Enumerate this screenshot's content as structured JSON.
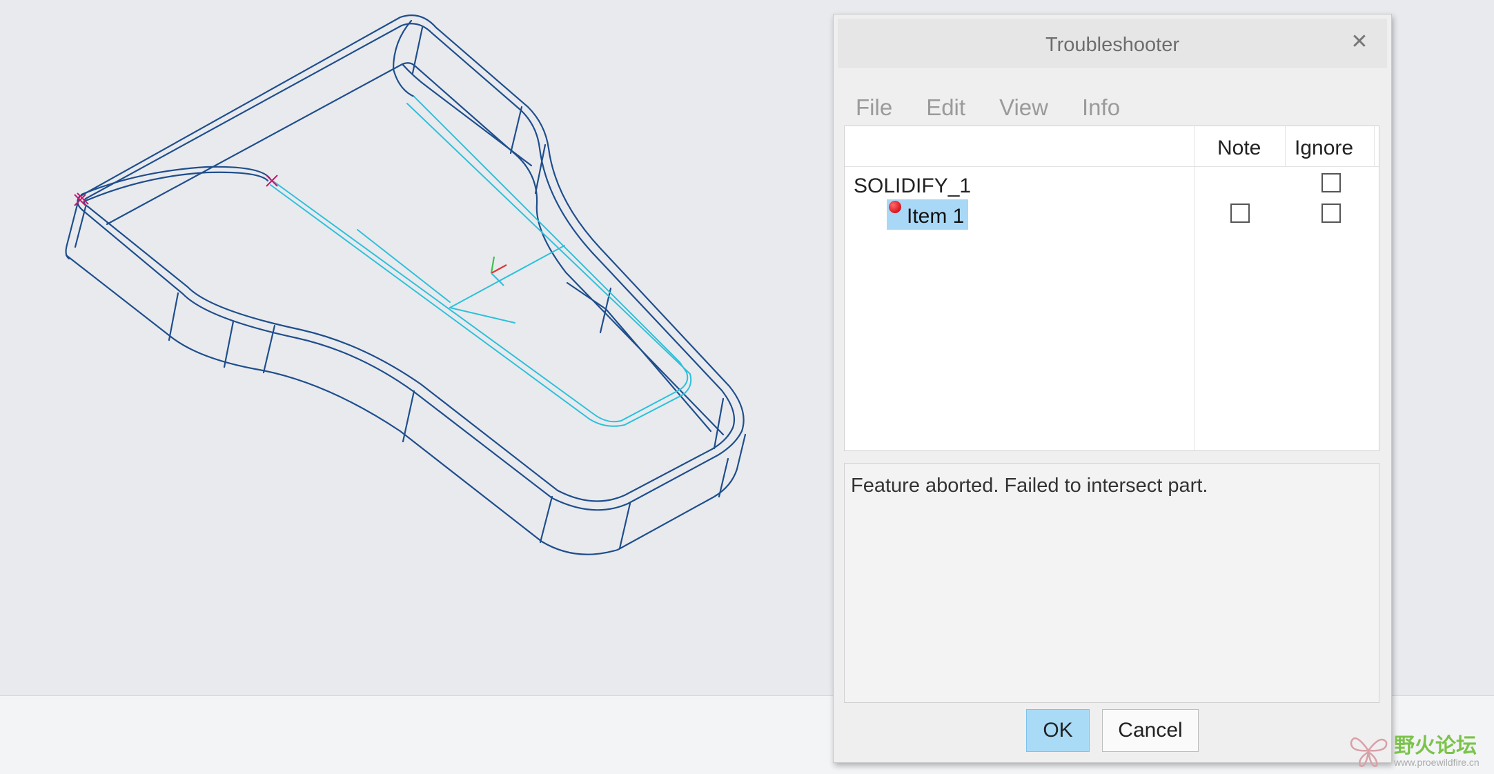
{
  "dialog": {
    "title": "Troubleshooter",
    "close_icon": "close-icon"
  },
  "menu": {
    "items": [
      {
        "label": "File"
      },
      {
        "label": "Edit"
      },
      {
        "label": "View"
      },
      {
        "label": "Info"
      }
    ]
  },
  "tree": {
    "columns": {
      "note": "Note",
      "ignore": "Ignore"
    },
    "root": {
      "label": "SOLIDIFY_1",
      "ignore_checked": false
    },
    "items": [
      {
        "label": "Item 1",
        "status_icon": "error-dot-icon",
        "status_color": "#e0161f",
        "selected": true,
        "note_checked": false,
        "ignore_checked": false
      }
    ]
  },
  "message": {
    "text": "Feature aborted. Failed to intersect part."
  },
  "buttons": {
    "ok": "OK",
    "cancel": "Cancel"
  },
  "watermark": {
    "text": "野火论坛",
    "url": "www.proewildfire.cn"
  },
  "colors": {
    "model_edges": "#1f4e8c",
    "sketch_lines": "#2ec0da",
    "selection": "#a8d8f6",
    "viewport_bg": "#e8eaee"
  }
}
